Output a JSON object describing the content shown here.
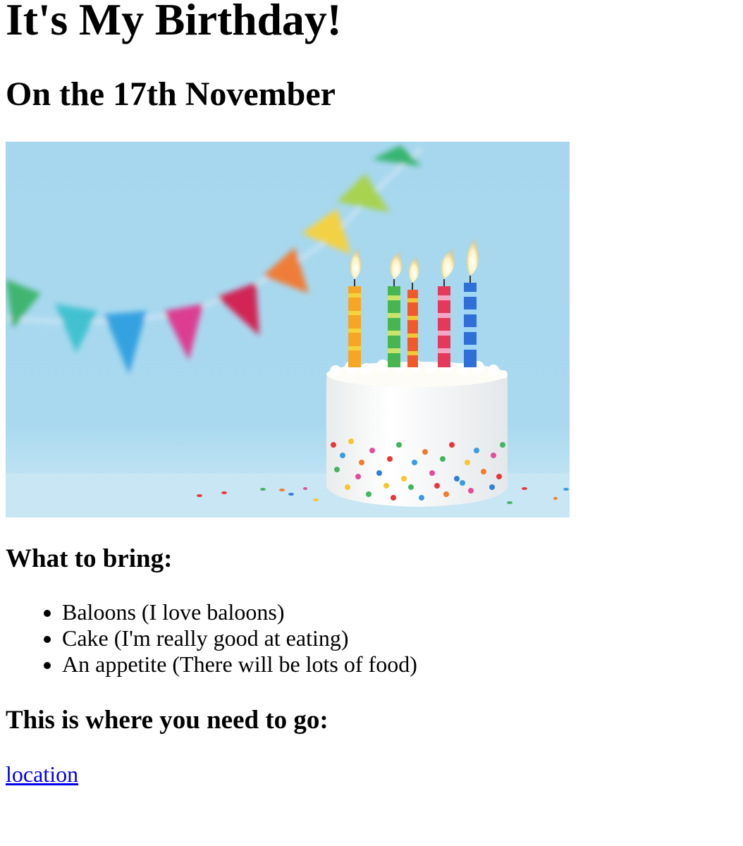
{
  "header": {
    "title": "It's My Birthday!",
    "date": "On the 17th November"
  },
  "hero": {
    "image": "birthday-cake-with-candles-and-bunting",
    "colors": {
      "background": "#a8d8ee",
      "frosting": "#fbfaf6"
    }
  },
  "bring": {
    "heading": "What to bring:",
    "items": [
      "Baloons (I love baloons)",
      "Cake (I'm really good at eating)",
      "An appetite (There will be lots of food)"
    ]
  },
  "directions": {
    "heading": "This is where you need to go:",
    "link_label": "location"
  }
}
